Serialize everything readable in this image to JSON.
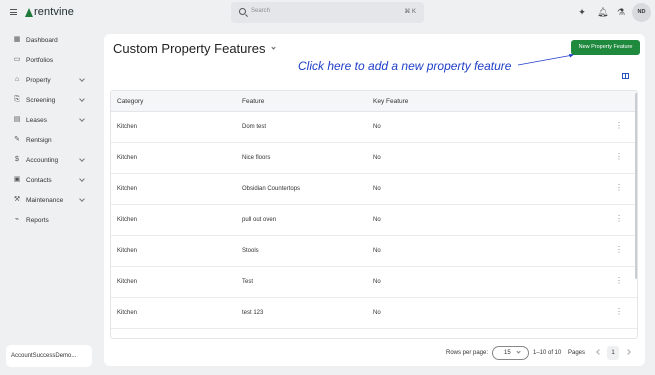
{
  "brand": {
    "name": "rentvine",
    "color": "#1f7a3a"
  },
  "search": {
    "placeholder": "Search",
    "shortcut": "⌘ K"
  },
  "top_icons": [
    "sparkle-icon",
    "bell-icon",
    "flask-icon"
  ],
  "user": {
    "initials": "ND"
  },
  "sidebar": {
    "items": [
      {
        "label": "Dashboard",
        "icon": "grid-icon",
        "expandable": false
      },
      {
        "label": "Portfolios",
        "icon": "folder-icon",
        "expandable": false
      },
      {
        "label": "Property",
        "icon": "building-icon",
        "expandable": true
      },
      {
        "label": "Screening",
        "icon": "document-search-icon",
        "expandable": true
      },
      {
        "label": "Leases",
        "icon": "lease-icon",
        "expandable": true
      },
      {
        "label": "Rentsign",
        "icon": "signature-icon",
        "expandable": false
      },
      {
        "label": "Accounting",
        "icon": "dollar-icon",
        "expandable": true
      },
      {
        "label": "Contacts",
        "icon": "contacts-icon",
        "expandable": true
      },
      {
        "label": "Maintenance",
        "icon": "wrench-icon",
        "expandable": true
      },
      {
        "label": "Reports",
        "icon": "chart-icon",
        "expandable": false
      }
    ],
    "account": "AccountSuccessDemo..."
  },
  "main": {
    "title": "Custom Property Features",
    "new_button": "New Property Feature",
    "callout": "Click here to add a new property feature",
    "callout_color": "#1f3ec8",
    "primary_color": "#1f8a3e",
    "table": {
      "columns": [
        "Category",
        "Feature",
        "Key Feature"
      ],
      "rows": [
        [
          "Kitchen",
          "Dom test",
          "No"
        ],
        [
          "Kitchen",
          "Nice floors",
          "No"
        ],
        [
          "Kitchen",
          "Obsidian Countertops",
          "No"
        ],
        [
          "Kitchen",
          "pull out oven",
          "No"
        ],
        [
          "Kitchen",
          "Stools",
          "No"
        ],
        [
          "Kitchen",
          "Test",
          "No"
        ],
        [
          "Kitchen",
          "test 123",
          "No"
        ]
      ]
    },
    "pagination": {
      "rows_label": "Rows per page:",
      "rows_value": "15",
      "range": "1–10 of 10",
      "pages_label": "Pages",
      "page": "1"
    }
  }
}
